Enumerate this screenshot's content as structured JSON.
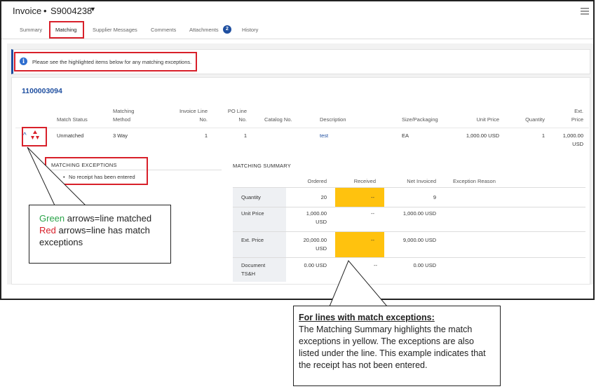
{
  "header": {
    "title_word": "Invoice",
    "title_sep": "•",
    "invoice_number": "S9004238"
  },
  "tabs": [
    {
      "label": "Summary"
    },
    {
      "label": "Matching"
    },
    {
      "label": "Supplier Messages"
    },
    {
      "label": "Comments"
    },
    {
      "label": "Attachments",
      "badge": "2"
    },
    {
      "label": "History"
    }
  ],
  "info": {
    "message": "Please see the highlighted items below for any matching exceptions."
  },
  "po": {
    "number": "1100003094"
  },
  "lines_table": {
    "headers": {
      "match_status": "Match Status",
      "matching_method_1": "Matching",
      "matching_method_2": "Method",
      "invoice_line_1": "Invoice Line",
      "invoice_line_2": "No.",
      "po_line_1": "PO Line",
      "po_line_2": "No.",
      "catalog": "Catalog No.",
      "description": "Description",
      "size": "Size/Packaging",
      "unit_price": "Unit Price",
      "quantity": "Quantity",
      "ext_price_1": "Ext.",
      "ext_price_2": "Price"
    },
    "row": {
      "match_status": "Unmatched",
      "matching_method": "3 Way",
      "invoice_line": "1",
      "po_line": "1",
      "catalog": "",
      "description": "test",
      "size": "EA",
      "unit_price": "1,000.00 USD",
      "quantity": "1",
      "ext_price_1": "1,000.00",
      "ext_price_2": "USD"
    }
  },
  "matching_exceptions": {
    "title": "MATCHING EXCEPTIONS",
    "items": [
      "No receipt has been entered"
    ]
  },
  "matching_summary": {
    "title": "MATCHING SUMMARY",
    "columns": {
      "ordered": "Ordered",
      "received": "Received",
      "net_invoiced": "Net Invoiced",
      "exception_reason": "Exception Reason"
    },
    "rows": {
      "quantity": {
        "label": "Quantity",
        "ordered": "20",
        "received": "--",
        "net_invoiced": "9"
      },
      "unit_price": {
        "label": "Unit Price",
        "ordered_1": "1,000.00",
        "ordered_2": "USD",
        "received": "--",
        "net_invoiced": "1,000.00 USD"
      },
      "ext_price": {
        "label": "Ext. Price",
        "ordered_1": "20,000.00",
        "ordered_2": "USD",
        "received": "--",
        "net_invoiced": "9,000.00 USD"
      },
      "document": {
        "label_1": "Document",
        "label_2": "TS&H",
        "ordered": "0.00 USD",
        "received": "--",
        "net_invoiced": "0.00 USD"
      }
    }
  },
  "callout_arrows": {
    "green_word": "Green",
    "green_rest": " arrows=line matched",
    "red_word": "Red",
    "red_rest": " arrows=line has match exceptions"
  },
  "callout_summary": {
    "heading": "For lines with match exceptions:",
    "body": "The Matching Summary highlights the match exceptions in yellow. The exceptions are also listed under the line. This example indicates that the receipt has not been entered."
  },
  "colors": {
    "accent": "#1f4fa0",
    "highlight_border": "#d8202a",
    "exception_yellow": "#ffc20e",
    "matched_green": "#2ba34a"
  },
  "icons": {
    "menu": "hamburger-menu-icon",
    "dropdown": "chevron-down-icon",
    "info": "info-icon",
    "expand": "chevron-up-icon",
    "match_status": "red-arrows-icon"
  }
}
